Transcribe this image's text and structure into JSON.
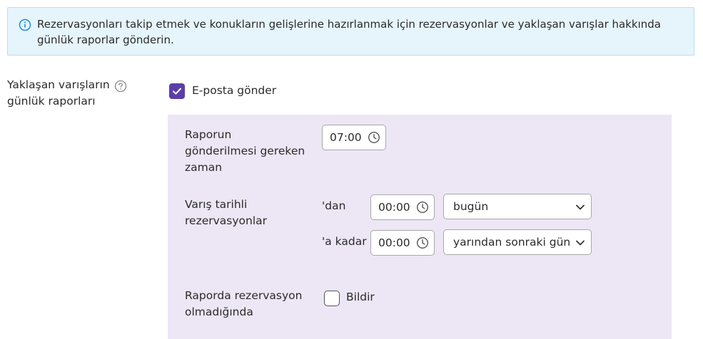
{
  "info": {
    "text": "Rezervasyonları takip etmek ve konukların gelişlerine hazırlanmak için rezervasyonlar ve yaklaşan varışlar hakkında günlük raporlar gönderin.",
    "icon": "info-circle-icon",
    "background": "#e6f4fc",
    "accent": "#1a8fd6"
  },
  "setting": {
    "label": "Yaklaşan varışların günlük raporları",
    "help_icon": "question-circle-icon",
    "send_email": {
      "label": "E-posta gönder",
      "checked": true
    }
  },
  "panel": {
    "background": "#ece6f5",
    "send_time": {
      "label": "Raporun gönderilmesi gereken zaman",
      "value": "07:00"
    },
    "arrival_range": {
      "label": "Varış tarihli rezervasyonlar",
      "from": {
        "prefix": "'dan",
        "time": "00:00",
        "day": "bugün"
      },
      "to": {
        "prefix": "'a kadar",
        "time": "00:00",
        "day": "yarından sonraki gün"
      }
    },
    "no_reservations": {
      "label": "Raporda rezervasyon olmadığında",
      "option_label": "Bildir",
      "checked": false
    }
  },
  "colors": {
    "checkbox_checked": "#5b3fa8",
    "text": "#2b2b2b"
  }
}
